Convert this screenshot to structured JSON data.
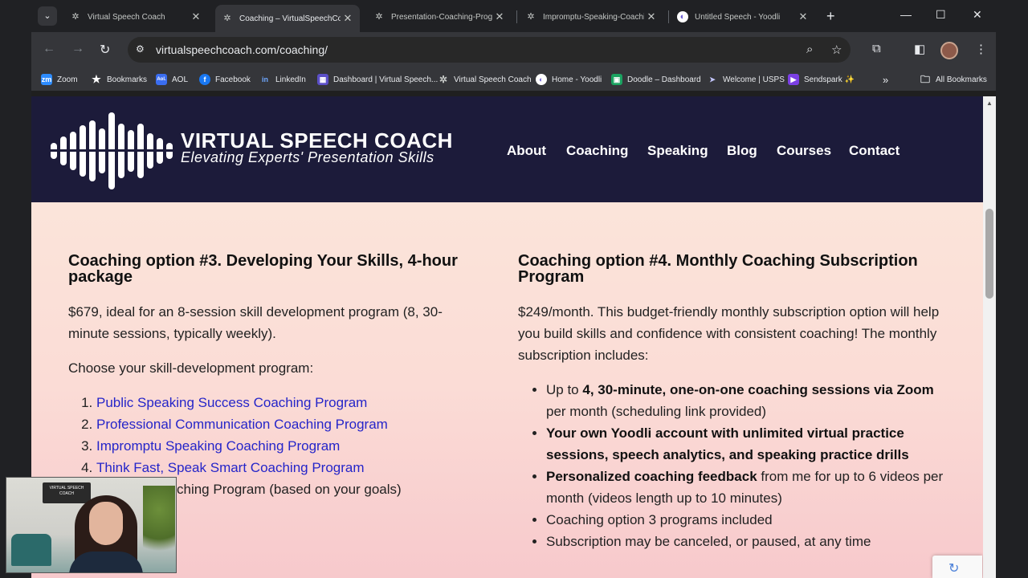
{
  "browser": {
    "tabs": [
      {
        "label": "Virtual Speech Coach",
        "icon": "gear-favicon-icon",
        "active": false
      },
      {
        "label": "Coaching – VirtualSpeechCoac",
        "icon": "gear-favicon-icon",
        "active": true
      },
      {
        "label": "Presentation-Coaching-Progra",
        "icon": "gear-favicon-icon",
        "active": false
      },
      {
        "label": "Impromptu-Speaking-Coachin",
        "icon": "gear-favicon-icon",
        "active": false
      },
      {
        "label": "Untitled Speech - Yoodli",
        "icon": "yoodli-favicon-icon",
        "active": false
      }
    ],
    "url": "virtualspeechcoach.com/coaching/",
    "bookmarks": [
      {
        "label": "Zoom",
        "icon": "zoom-icon",
        "badge": "zm",
        "color": "#2d8cff"
      },
      {
        "label": "Bookmarks",
        "icon": "star-icon",
        "badge": "★",
        "color": "#35363a"
      },
      {
        "label": "AOL",
        "icon": "aol-icon",
        "badge": "Aol.",
        "color": "#3a6df0"
      },
      {
        "label": "Facebook",
        "icon": "facebook-icon",
        "badge": "f",
        "color": "#1877f2"
      },
      {
        "label": "LinkedIn",
        "icon": "linkedin-icon",
        "badge": "in",
        "color": "#35363a"
      },
      {
        "label": "Dashboard | Virtual Speech...",
        "icon": "dashboard-icon",
        "badge": "▦",
        "color": "#5b4fc7"
      },
      {
        "label": "Virtual Speech Coach",
        "icon": "gear-favicon-icon",
        "badge": "✲",
        "color": "#35363a"
      },
      {
        "label": "Home - Yoodli",
        "icon": "yoodli-favicon-icon",
        "badge": "◐",
        "color": "#6d5dd3"
      },
      {
        "label": "Doodle – Dashboard",
        "icon": "doodle-icon",
        "badge": "▣",
        "color": "#1aa260"
      },
      {
        "label": "Welcome | USPS",
        "icon": "usps-icon",
        "badge": "➤",
        "color": "#35363a"
      },
      {
        "label": "Sendspark ✨",
        "icon": "sendspark-icon",
        "badge": "▶",
        "color": "#7b3fe4"
      }
    ],
    "all_bookmarks": "All Bookmarks"
  },
  "site": {
    "logo_title": "VIRTUAL SPEECH COACH",
    "logo_subtitle": "Elevating Experts' Presentation Skills",
    "nav": [
      "About",
      "Coaching",
      "Speaking",
      "Blog",
      "Courses",
      "Contact"
    ]
  },
  "option3": {
    "title": "Coaching option #3. Developing Your Skills, 4-hour package",
    "price_text": "$679, ideal for an 8-session skill development program (8, 30-minute sessions, typically weekly).",
    "choose_text": "Choose your skill-development program:",
    "programs": [
      "Public Speaking Success Coaching Program",
      "Professional Communication Coaching Program",
      "Impromptu Speaking Coaching Program",
      "Think Fast, Speak Smart Coaching Program"
    ],
    "item5_partial": "ching Program (based on your goals)"
  },
  "option4": {
    "title": "Coaching option #4. Monthly Coaching Subscription Program",
    "intro": "$249/month. This budget-friendly monthly subscription option will help you build skills and confidence with consistent coaching! The monthly",
    "intro_cont": "subscription includes:",
    "bullets": [
      {
        "pre": "Up to ",
        "bold": "4, 30-minute, one-on-one coaching sessions via Zoom",
        "post": " per month (scheduling link provided)"
      },
      {
        "pre": "",
        "bold": "Your own Yoodli account with unlimited virtual practice sessions, speech analytics, and speaking practice drills",
        "post": ""
      },
      {
        "pre": "",
        "bold": "Personalized coaching feedback",
        "post": " from me for up to 6 videos per month (videos length up to 10 minutes)"
      },
      {
        "pre": "Coaching option 3  programs included",
        "bold": "",
        "post": ""
      },
      {
        "pre": "Subscription may be canceled, or paused, at any time",
        "bold": "",
        "post": ""
      }
    ]
  },
  "webcam_logo_text": "VIRTUAL SPEECH COACH"
}
